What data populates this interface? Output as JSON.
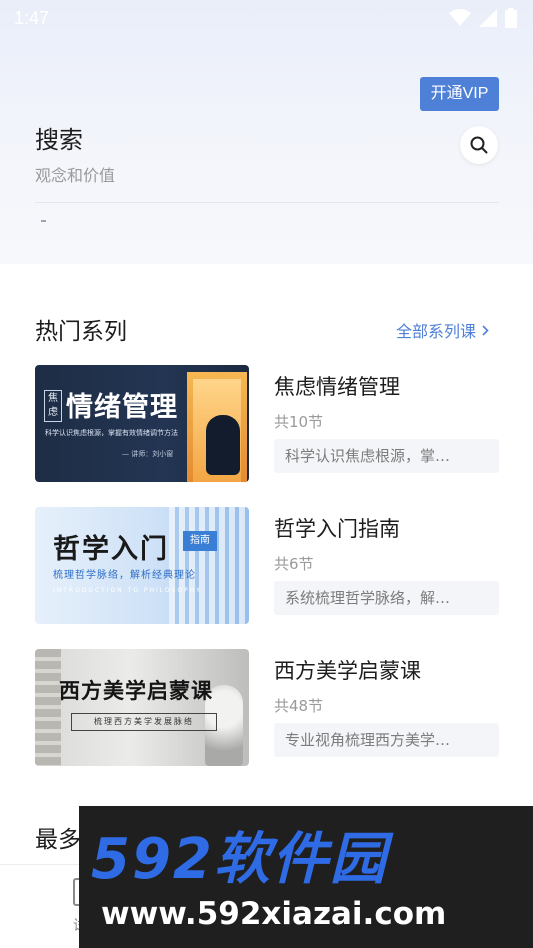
{
  "status_bar": {
    "time": "1:47"
  },
  "header": {
    "vip_label": "开通VIP",
    "search_title": "搜索",
    "search_subtitle": "观念和价值"
  },
  "hot_section": {
    "title": "热门系列",
    "all_link": "全部系列课",
    "courses": [
      {
        "name": "焦虑情绪管理",
        "count": "共10节",
        "desc": "科学认识焦虑根源，掌…",
        "thumb": {
          "tag": "焦虑",
          "title": "情绪管理",
          "line": "科学认识焦虑根源，掌握有效情绪调节方法",
          "author": "— 讲师：刘小窗"
        }
      },
      {
        "name": "哲学入门指南",
        "count": "共6节",
        "desc": "系统梳理哲学脉络，解…",
        "thumb": {
          "title": "哲学入门",
          "tag": "指南",
          "line": "梳理哲学脉络，解析经典理论",
          "en": "INTRODUCTION TO PHILOSOPHY"
        }
      },
      {
        "name": "西方美学启蒙课",
        "count": "共48节",
        "desc": "专业视角梳理西方美学…",
        "thumb": {
          "title": "西方美学启蒙课",
          "box": "梳理西方美学发展脉络"
        }
      }
    ]
  },
  "more_section": {
    "title": "最多"
  },
  "bottom_nav": {
    "label": "试"
  },
  "watermark": {
    "brand": "592软件园",
    "url": "www.592xiazai.com"
  },
  "colors": {
    "accent": "#4f80d7",
    "watermark_blue": "#2e6be5"
  }
}
